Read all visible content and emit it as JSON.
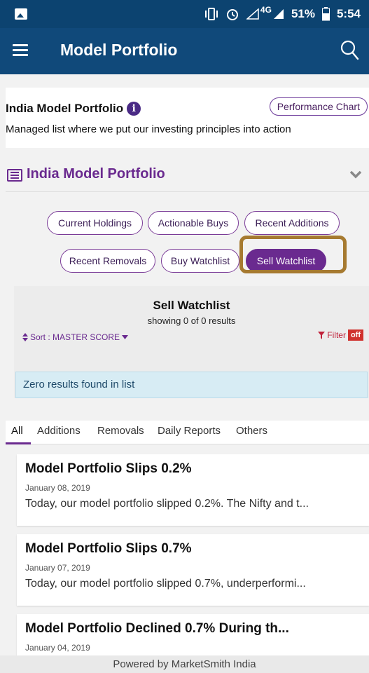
{
  "status_bar": {
    "battery_percent": "51%",
    "time": "5:54",
    "network": "4G",
    "icons": [
      "gallery-icon",
      "vibrate-icon",
      "alarm-icon",
      "signal-icon",
      "battery-icon"
    ]
  },
  "app_bar": {
    "title": "Model Portfolio",
    "icons": [
      "menu-icon",
      "search-icon"
    ]
  },
  "intro": {
    "title": "India Model Portfolio",
    "performance_button": "Performance Chart",
    "description": "Managed list where we put our investing principles into action"
  },
  "section": {
    "title": "India Model Portfolio"
  },
  "list_tabs": [
    {
      "label": "Current Holdings",
      "active": false
    },
    {
      "label": "Actionable Buys",
      "active": false
    },
    {
      "label": "Recent Additions",
      "active": false
    },
    {
      "label": "Recent Removals",
      "active": false
    },
    {
      "label": "Buy Watchlist",
      "active": false
    },
    {
      "label": "Sell Watchlist",
      "active": true
    }
  ],
  "list_panel": {
    "heading": "Sell Watchlist",
    "count_text": "showing 0 of 0 results",
    "sort_label": "Sort : MASTER SCORE",
    "filter_label": "Filter",
    "filter_state": "off",
    "empty_message": "Zero results found in list"
  },
  "news_tabs": [
    "All",
    "Additions",
    "Removals",
    "Daily Reports",
    "Others"
  ],
  "articles": [
    {
      "title": "Model Portfolio Slips 0.2%",
      "date": "January 08, 2019",
      "snippet": "Today, our model portfolio slipped 0.2%. The Nifty and t..."
    },
    {
      "title": "Model Portfolio Slips 0.7%",
      "date": "January 07, 2019",
      "snippet": "Today, our model portfolio slipped 0.7%, underperformi..."
    },
    {
      "title": "Model Portfolio Declined 0.7% During th...",
      "date": "January 04, 2019",
      "snippet": ""
    }
  ],
  "footer": {
    "text": "Powered by MarketSmith India"
  },
  "colors": {
    "app_bar": "#10497a",
    "accent_purple": "#6a2a8f",
    "highlight": "#a67a30",
    "info_box": "#d7ecf4"
  }
}
